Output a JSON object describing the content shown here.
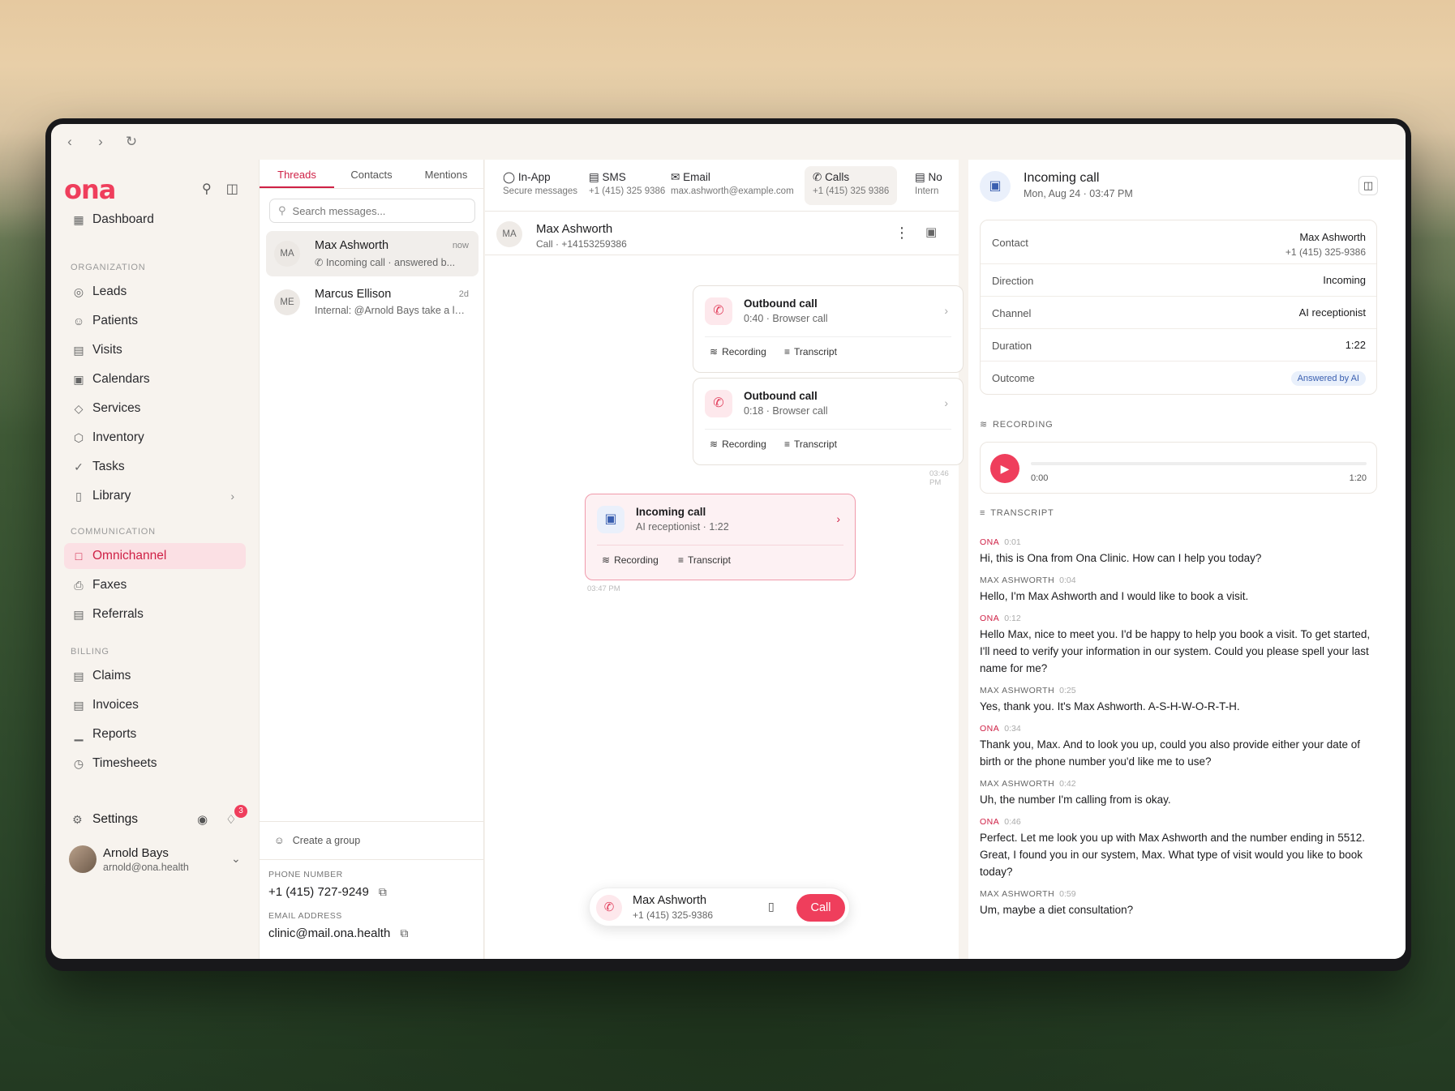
{
  "browser": {
    "back": "‹",
    "forward": "›",
    "reload": "↻"
  },
  "nav": {
    "logo": "ona",
    "dashboard": "Dashboard",
    "sections": {
      "organization": "ORGANIZATION",
      "communication": "COMMUNICATION",
      "billing": "BILLING"
    },
    "organization": [
      "Leads",
      "Patients",
      "Visits",
      "Calendars",
      "Services",
      "Inventory",
      "Tasks",
      "Library"
    ],
    "communication": [
      "Omnichannel",
      "Faxes",
      "Referrals"
    ],
    "billing": [
      "Claims",
      "Invoices",
      "Reports",
      "Timesheets"
    ],
    "active": "Omnichannel",
    "settings": "Settings",
    "notification_count": "3",
    "user": {
      "name": "Arnold Bays",
      "email": "arnold@ona.health"
    }
  },
  "threads": {
    "tabs": [
      "Threads",
      "Contacts",
      "Mentions"
    ],
    "active_tab": "Threads",
    "search_placeholder": "Search messages...",
    "items": [
      {
        "initials": "MA",
        "name": "Max Ashworth",
        "time": "now",
        "preview": "Incoming call · answered b...",
        "selected": true
      },
      {
        "initials": "ME",
        "name": "Marcus Ellison",
        "time": "2d",
        "preview": "Internal: @Arnold Bays take a loo...",
        "selected": false
      }
    ],
    "create_group": "Create a group",
    "phone_label": "PHONE NUMBER",
    "phone": "+1 (415) 727-9249",
    "email_label": "EMAIL ADDRESS",
    "email": "clinic@mail.ona.health"
  },
  "channels": [
    {
      "title": "In-App",
      "sub": "Secure messages"
    },
    {
      "title": "SMS",
      "sub": "+1 (415) 325 9386"
    },
    {
      "title": "Email",
      "sub": "max.ashworth@example.com"
    },
    {
      "title": "Calls",
      "sub": "+1 (415) 325 9386",
      "active": true
    },
    {
      "title": "No",
      "sub": "Intern"
    }
  ],
  "conversation": {
    "initials": "MA",
    "name": "Max Ashworth",
    "sub": "Call · +14153259386",
    "cards": [
      {
        "title": "Outbound call",
        "sub": "0:40 · Browser call",
        "recording": "Recording",
        "transcript": "Transcript"
      },
      {
        "title": "Outbound call",
        "sub": "0:18 · Browser call",
        "recording": "Recording",
        "transcript": "Transcript"
      },
      {
        "title": "Incoming call",
        "sub": "AI receptionist · 1:22",
        "recording": "Recording",
        "transcript": "Transcript"
      }
    ],
    "stamp1": "03:46 PM",
    "stamp2": "03:47 PM",
    "dialer": {
      "name": "Max Ashworth",
      "number": "+1 (415) 325-9386",
      "call": "Call"
    }
  },
  "detail": {
    "title": "Incoming call",
    "subtitle": "Mon, Aug 24 · 03:47 PM",
    "props": {
      "contact_label": "Contact",
      "contact_name": "Max Ashworth",
      "contact_phone": "+1 (415) 325-9386",
      "direction_label": "Direction",
      "direction": "Incoming",
      "channel_label": "Channel",
      "channel": "AI receptionist",
      "duration_label": "Duration",
      "duration": "1:22",
      "outcome_label": "Outcome",
      "outcome": "Answered by AI"
    },
    "recording_label": "RECORDING",
    "recording": {
      "current": "0:00",
      "total": "1:20",
      "progress": 0
    },
    "transcript_label": "TRANSCRIPT",
    "transcript": [
      {
        "speaker": "ONA",
        "time": "0:01",
        "ai": true,
        "text": "Hi, this is Ona from Ona Clinic. How can I help you today?"
      },
      {
        "speaker": "MAX ASHWORTH",
        "time": "0:04",
        "ai": false,
        "text": "Hello, I'm Max Ashworth and I would like to book a visit."
      },
      {
        "speaker": "ONA",
        "time": "0:12",
        "ai": true,
        "text": "Hello Max, nice to meet you. I'd be happy to help you book a visit. To get started, I'll need to verify your information in our system. Could you please spell your last name for me?"
      },
      {
        "speaker": "MAX ASHWORTH",
        "time": "0:25",
        "ai": false,
        "text": "Yes, thank you. It's Max Ashworth. A-S-H-W-O-R-T-H."
      },
      {
        "speaker": "ONA",
        "time": "0:34",
        "ai": true,
        "text": "Thank you, Max. And to look you up, could you also provide either your date of birth or the phone number you'd like me to use?"
      },
      {
        "speaker": "MAX ASHWORTH",
        "time": "0:42",
        "ai": false,
        "text": "Uh, the number I'm calling from is okay."
      },
      {
        "speaker": "ONA",
        "time": "0:46",
        "ai": true,
        "text": "Perfect. Let me look you up with Max Ashworth and the number ending in 5512. Great, I found you in our system, Max. What type of visit would you like to book today?"
      },
      {
        "speaker": "MAX ASHWORTH",
        "time": "0:59",
        "ai": false,
        "text": "Um, maybe a diet consultation?"
      }
    ]
  }
}
